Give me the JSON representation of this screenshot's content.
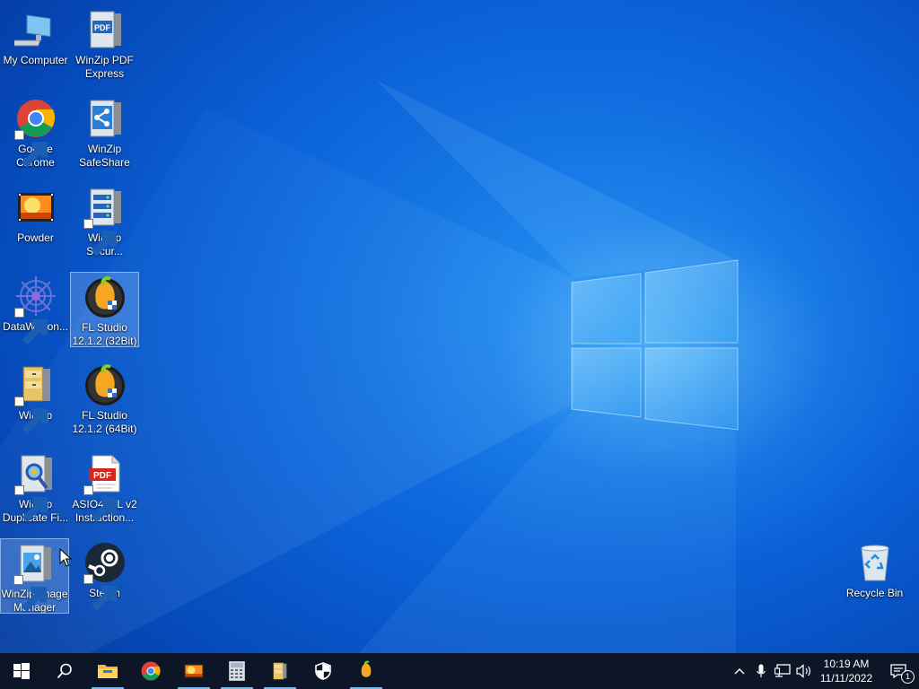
{
  "desktop_icons": [
    {
      "id": "my-computer",
      "label": "My Computer",
      "shortcut": false
    },
    {
      "id": "winzip-pdf-express",
      "label": "WinZip PDF Express",
      "shortcut": false
    },
    {
      "id": "google-chrome",
      "label": "Google Chrome",
      "shortcut": true
    },
    {
      "id": "winzip-safeshare",
      "label": "WinZip SafeShare",
      "shortcut": false
    },
    {
      "id": "powder",
      "label": "Powder",
      "shortcut": false
    },
    {
      "id": "winzip-secure",
      "label": "WinZip Secur...",
      "shortcut": true
    },
    {
      "id": "datawagon",
      "label": "DataWagon...",
      "shortcut": true
    },
    {
      "id": "fl-studio-32",
      "label": "FL Studio 12.1.2 (32Bit)",
      "shortcut": false,
      "selected": true
    },
    {
      "id": "winzip",
      "label": "WinZip",
      "shortcut": true
    },
    {
      "id": "fl-studio-64",
      "label": "FL Studio 12.1.2 (64Bit)",
      "shortcut": false
    },
    {
      "id": "winzip-duplicate",
      "label": "WinZip Duplicate Fi...",
      "shortcut": true
    },
    {
      "id": "asio4all",
      "label": "ASIO4ALL v2 Instruction...",
      "shortcut": true
    },
    {
      "id": "winzip-image-manager",
      "label": "WinZip Image Manager",
      "shortcut": true,
      "selected": true
    },
    {
      "id": "steam",
      "label": "Steam",
      "shortcut": true
    },
    {
      "id": "recycle-bin",
      "label": "Recycle Bin",
      "shortcut": false
    }
  ],
  "taskbar": {
    "pinned": [
      {
        "id": "start",
        "icon": "windows-logo-icon"
      },
      {
        "id": "search",
        "icon": "search-icon"
      },
      {
        "id": "file-explorer",
        "icon": "folder-icon",
        "running": true
      },
      {
        "id": "chrome",
        "icon": "chrome-icon"
      },
      {
        "id": "powder",
        "icon": "powder-icon",
        "running": true
      },
      {
        "id": "calculator",
        "icon": "calculator-icon",
        "running": true
      },
      {
        "id": "winzip",
        "icon": "winzip-icon",
        "running": true
      },
      {
        "id": "security",
        "icon": "shield-icon"
      },
      {
        "id": "fl-studio",
        "icon": "fl-studio-icon",
        "running": true
      }
    ],
    "tray": {
      "time": "10:19 AM",
      "date": "11/11/2022",
      "notification_count": "1"
    }
  },
  "colors": {
    "desktop_blue": "#0b62d8",
    "taskbar": "#0c1627",
    "running_indicator": "#76b9ed"
  }
}
